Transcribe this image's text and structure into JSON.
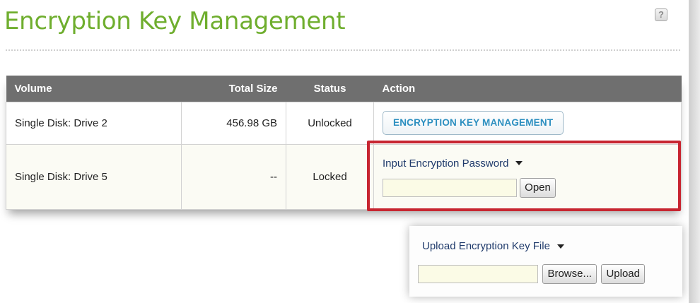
{
  "page": {
    "title": "Encryption Key Management",
    "help_icon": "help-icon"
  },
  "table": {
    "columns": [
      "Volume",
      "Total Size",
      "Status",
      "Action"
    ],
    "rows": [
      {
        "volume": "Single Disk: Drive 2",
        "total_size": "456.98 GB",
        "status": "Unlocked",
        "action_button": "ENCRYPTION KEY MANAGEMENT"
      },
      {
        "volume": "Single Disk: Drive 5",
        "total_size": "--",
        "status": "Locked",
        "action_select": "Input Encryption Password",
        "password_value": "",
        "open_button": "Open"
      }
    ]
  },
  "upload": {
    "select": "Upload Encryption Key File",
    "file_value": "",
    "browse_button": "Browse...",
    "upload_button": "Upload"
  },
  "colors": {
    "title": "#6fae2e",
    "header_bg": "#6f6f6f",
    "highlight": "#c72530",
    "link_button": "#2c8fc0"
  }
}
